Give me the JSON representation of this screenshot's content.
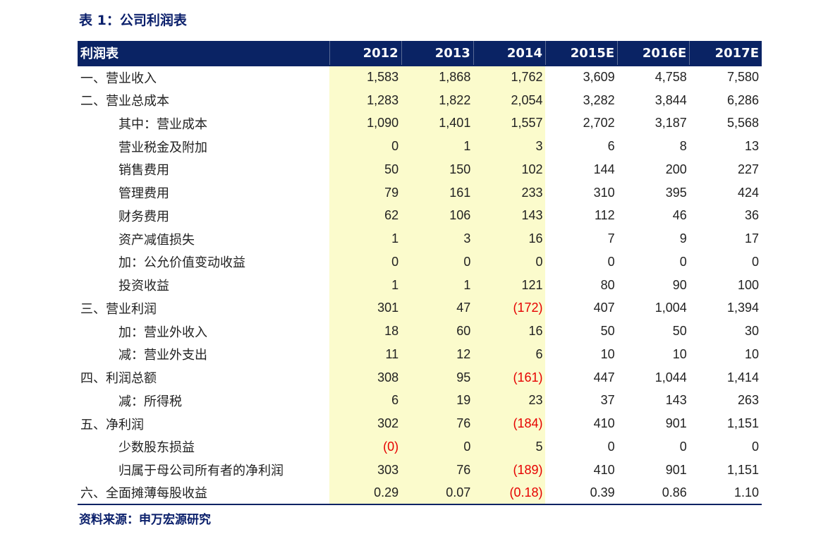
{
  "title": "表 1：公司利润表",
  "table": {
    "headers": [
      "利润表",
      "2012",
      "2013",
      "2014",
      "2015E",
      "2016E",
      "2017E"
    ],
    "rows": [
      {
        "label": "一、营业收入",
        "indent": false,
        "values": [
          "1,583",
          "1,868",
          "1,762",
          "3,609",
          "4,758",
          "7,580"
        ]
      },
      {
        "label": "二、营业总成本",
        "indent": false,
        "values": [
          "1,283",
          "1,822",
          "2,054",
          "3,282",
          "3,844",
          "6,286"
        ]
      },
      {
        "label": "其中：营业成本",
        "indent": true,
        "values": [
          "1,090",
          "1,401",
          "1,557",
          "2,702",
          "3,187",
          "5,568"
        ]
      },
      {
        "label": "营业税金及附加",
        "indent": true,
        "values": [
          "0",
          "1",
          "3",
          "6",
          "8",
          "13"
        ]
      },
      {
        "label": "销售费用",
        "indent": true,
        "values": [
          "50",
          "150",
          "102",
          "144",
          "200",
          "227"
        ]
      },
      {
        "label": "管理费用",
        "indent": true,
        "values": [
          "79",
          "161",
          "233",
          "310",
          "395",
          "424"
        ]
      },
      {
        "label": "财务费用",
        "indent": true,
        "values": [
          "62",
          "106",
          "143",
          "112",
          "46",
          "36"
        ]
      },
      {
        "label": "资产减值损失",
        "indent": true,
        "values": [
          "1",
          "3",
          "16",
          "7",
          "9",
          "17"
        ]
      },
      {
        "label": "加：公允价值变动收益",
        "indent": true,
        "values": [
          "0",
          "0",
          "0",
          "0",
          "0",
          "0"
        ]
      },
      {
        "label": "投资收益",
        "indent": true,
        "values": [
          "1",
          "1",
          "121",
          "80",
          "90",
          "100"
        ]
      },
      {
        "label": "三、营业利润",
        "indent": false,
        "values": [
          "301",
          "47",
          "(172)",
          "407",
          "1,004",
          "1,394"
        ]
      },
      {
        "label": "加：营业外收入",
        "indent": true,
        "values": [
          "18",
          "60",
          "16",
          "50",
          "50",
          "30"
        ]
      },
      {
        "label": "减：营业外支出",
        "indent": true,
        "values": [
          "11",
          "12",
          "6",
          "10",
          "10",
          "10"
        ]
      },
      {
        "label": "四、利润总额",
        "indent": false,
        "values": [
          "308",
          "95",
          "(161)",
          "447",
          "1,044",
          "1,414"
        ]
      },
      {
        "label": "减：所得税",
        "indent": true,
        "values": [
          "6",
          "19",
          "23",
          "37",
          "143",
          "263"
        ]
      },
      {
        "label": "五、净利润",
        "indent": false,
        "values": [
          "302",
          "76",
          "(184)",
          "410",
          "901",
          "1,151"
        ]
      },
      {
        "label": "少数股东损益",
        "indent": true,
        "values": [
          "(0)",
          "0",
          "5",
          "0",
          "0",
          "0"
        ]
      },
      {
        "label": "归属于母公司所有者的净利润",
        "indent": true,
        "values": [
          "303",
          "76",
          "(189)",
          "410",
          "901",
          "1,151"
        ]
      },
      {
        "label": "六、全面摊薄每股收益",
        "indent": false,
        "values": [
          "0.29",
          "0.07",
          "(0.18)",
          "0.39",
          "0.86",
          "1.10"
        ]
      }
    ]
  },
  "source": "资料来源：申万宏源研究",
  "colors": {
    "header_bg": "#0a2364",
    "highlight_bg": "#fbfbcc",
    "negative_text": "#e60000",
    "title_text": "#0a1f6b"
  }
}
